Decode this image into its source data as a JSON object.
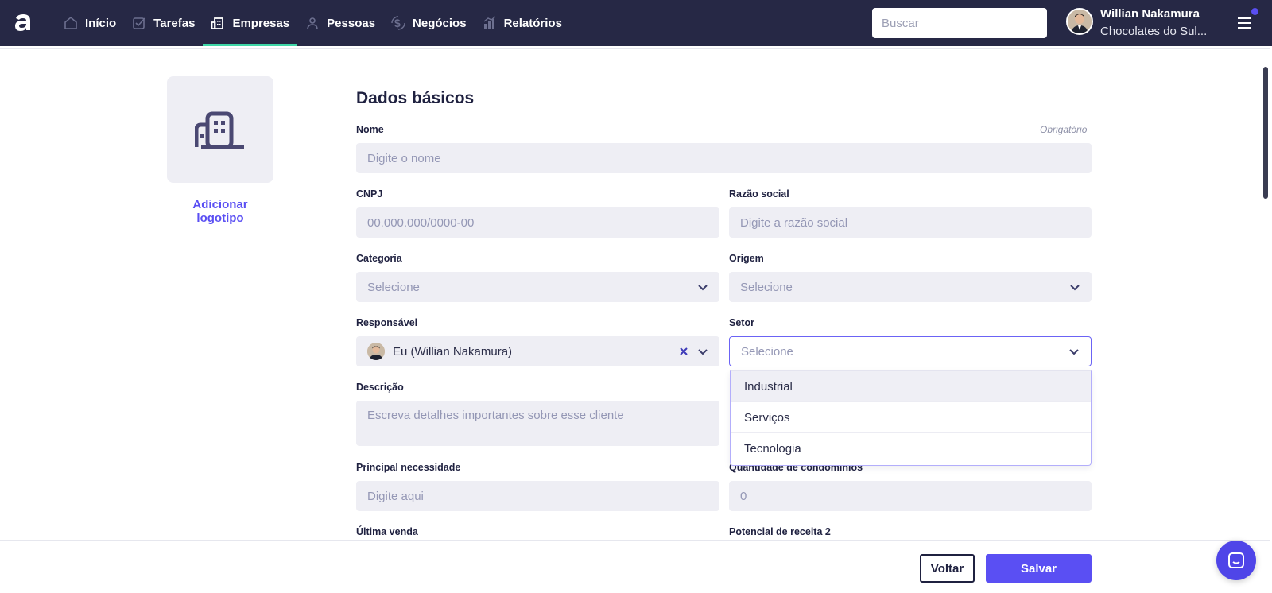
{
  "nav": {
    "items": [
      {
        "label": "Início",
        "icon": "home-icon"
      },
      {
        "label": "Tarefas",
        "icon": "check-square-icon"
      },
      {
        "label": "Empresas",
        "icon": "building-icon",
        "active": true
      },
      {
        "label": "Pessoas",
        "icon": "person-icon"
      },
      {
        "label": "Negócios",
        "icon": "dollar-icon"
      },
      {
        "label": "Relatórios",
        "icon": "chart-icon"
      }
    ]
  },
  "search": {
    "placeholder": "Buscar"
  },
  "user": {
    "name": "Willian Nakamura",
    "company": "Chocolates do Sul..."
  },
  "sidebar": {
    "add_logo": "Adicionar logotipo"
  },
  "form": {
    "title": "Dados básicos",
    "required_note": "Obrigatório",
    "nome": {
      "label": "Nome",
      "placeholder": "Digite o nome"
    },
    "cnpj": {
      "label": "CNPJ",
      "placeholder": "00.000.000/0000-00"
    },
    "razao": {
      "label": "Razão social",
      "placeholder": "Digite a razão social"
    },
    "categoria": {
      "label": "Categoria",
      "value": "Selecione"
    },
    "origem": {
      "label": "Origem",
      "value": "Selecione"
    },
    "responsavel": {
      "label": "Responsável",
      "value": "Eu (Willian Nakamura)"
    },
    "setor": {
      "label": "Setor",
      "value": "Selecione",
      "options": [
        "Industrial",
        "Serviços",
        "Tecnologia"
      ]
    },
    "descricao": {
      "label": "Descrição",
      "placeholder": "Escreva detalhes importantes sobre esse cliente"
    },
    "necessidade": {
      "label": "Principal necessidade",
      "placeholder": "Digite aqui"
    },
    "condominios": {
      "label": "Quantidade de condomínios",
      "value": "0"
    },
    "ultima_venda": {
      "label": "Última venda"
    },
    "potencial": {
      "label": "Potencial de receita 2"
    }
  },
  "footer": {
    "back": "Voltar",
    "save": "Salvar"
  },
  "colors": {
    "nav_bg": "#262845",
    "accent": "#5a4ff3",
    "active_tab": "#3ed6a7",
    "field_bg": "#eeeef4"
  }
}
